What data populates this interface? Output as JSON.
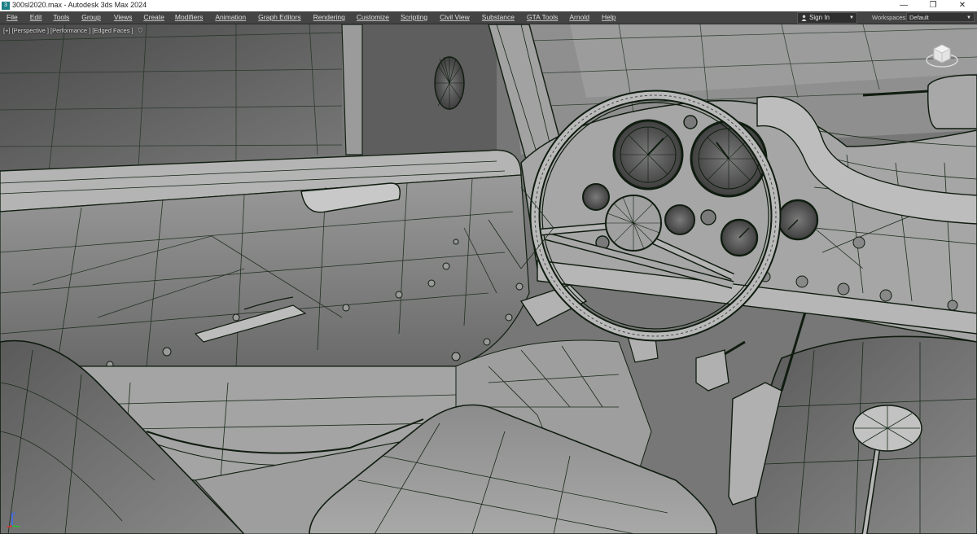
{
  "window": {
    "title": "300sl2020.max - Autodesk 3ds Max 2024",
    "buttons": [
      "—",
      "❐",
      "✕"
    ]
  },
  "menubar": {
    "items": [
      "File",
      "Edit",
      "Tools",
      "Group",
      "Views",
      "Create",
      "Modifiers",
      "Animation",
      "Graph Editors",
      "Rendering",
      "Customize",
      "Scripting",
      "Civil View",
      "Substance",
      "GTA Tools",
      "Arnold",
      "Help"
    ],
    "signin_label": "Sign In",
    "workspaces_label": "Workspaces:",
    "workspace_value": "Default"
  },
  "viewport": {
    "labels": [
      "[+]",
      "[Perspective ]",
      "[Performance ]",
      "[Edged Faces ]"
    ],
    "filter_icon": "funnel-icon",
    "viewcube_label": "viewcube",
    "colors": {
      "shaded": "#8a8a8a",
      "wire": "#0d2a0d",
      "edges": "#1b3b1b"
    }
  }
}
